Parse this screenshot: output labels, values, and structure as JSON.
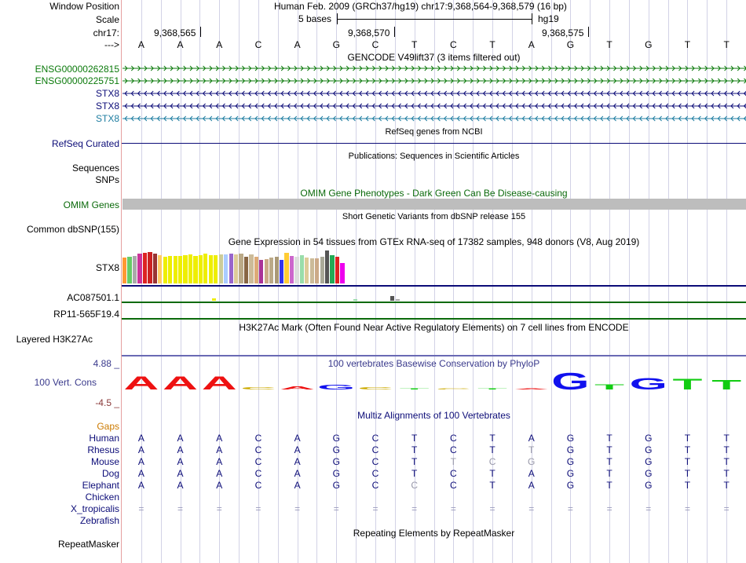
{
  "header": {
    "window_position_label": "Window Position",
    "window_position_value": "Human Feb. 2009 (GRCh37/hg19)   chr17:9,368,564-9,368,579 (16 bp)",
    "scale_label": "Scale",
    "scale_text": "5 bases",
    "scale_assembly": "hg19",
    "chrom_label": "chr17:",
    "strand_label": "--->",
    "ticks": [
      "9,368,565",
      "9,368,570",
      "9,368,575"
    ]
  },
  "dna_sequence": [
    "A",
    "A",
    "A",
    "C",
    "A",
    "G",
    "C",
    "T",
    "C",
    "T",
    "A",
    "G",
    "T",
    "G",
    "T",
    "T"
  ],
  "gencode": {
    "title": "GENCODE V49lift37 (3 items filtered out)",
    "tracks": [
      {
        "label": "ENSG00000262815",
        "strand": "forward",
        "color": "#0b7a0b"
      },
      {
        "label": "ENSG00000225751",
        "strand": "forward",
        "color": "#0b7a0b"
      },
      {
        "label": "STX8",
        "strand": "reverse",
        "color": "#0c0c78"
      },
      {
        "label": "STX8",
        "strand": "reverse",
        "color": "#0c0c78"
      },
      {
        "label": "STX8",
        "strand": "reverse",
        "color": "#1c7ca0"
      }
    ]
  },
  "refseq": {
    "title": "RefSeq genes from NCBI",
    "label": "RefSeq Curated"
  },
  "publications": {
    "title": "Publications: Sequences in Scientific Articles",
    "labels": [
      "Sequences",
      "SNPs"
    ]
  },
  "omim": {
    "title": "OMIM Gene Phenotypes - Dark Green Can Be Disease-causing",
    "label": "OMIM Genes"
  },
  "dbsnp": {
    "title": "Short Genetic Variants from dbSNP release 155",
    "label": "Common dbSNP(155)"
  },
  "gtex": {
    "title": "Gene Expression in 54 tissues from GTEx RNA-seq of 17382 samples, 948 donors (V8, Aug 2019)",
    "genes": [
      "STX8",
      "AC087501.1",
      "RP11-565F19.4"
    ],
    "stx8_bars": [
      {
        "c": "#ff9933",
        "v": 0.78
      },
      {
        "c": "#66cc66",
        "v": 0.82
      },
      {
        "c": "#aaaaaa",
        "v": 0.84
      },
      {
        "c": "#cc3399",
        "v": 0.9
      },
      {
        "c": "#dd2222",
        "v": 0.92
      },
      {
        "c": "#cc2222",
        "v": 0.96
      },
      {
        "c": "#993333",
        "v": 0.9
      },
      {
        "c": "#ffcc66",
        "v": 0.86
      },
      {
        "c": "#eeee00",
        "v": 0.82
      },
      {
        "c": "#eeee00",
        "v": 0.84
      },
      {
        "c": "#eeee00",
        "v": 0.84
      },
      {
        "c": "#eeee00",
        "v": 0.84
      },
      {
        "c": "#eeee00",
        "v": 0.86
      },
      {
        "c": "#eeee00",
        "v": 0.88
      },
      {
        "c": "#eeee00",
        "v": 0.84
      },
      {
        "c": "#eeee00",
        "v": 0.86
      },
      {
        "c": "#eeee00",
        "v": 0.9
      },
      {
        "c": "#eeee00",
        "v": 0.86
      },
      {
        "c": "#eeee00",
        "v": 0.86
      },
      {
        "c": "#cccc99",
        "v": 0.88
      },
      {
        "c": "#aaccff",
        "v": 0.88
      },
      {
        "c": "#9966cc",
        "v": 0.9
      },
      {
        "c": "#ddcc99",
        "v": 0.88
      },
      {
        "c": "#bbaa88",
        "v": 0.9
      },
      {
        "c": "#886644",
        "v": 0.8
      },
      {
        "c": "#ccbb99",
        "v": 0.88
      },
      {
        "c": "#ddaa77",
        "v": 0.8
      },
      {
        "c": "#aa3399",
        "v": 0.72
      },
      {
        "c": "#ccaa88",
        "v": 0.74
      },
      {
        "c": "#bbaa88",
        "v": 0.78
      },
      {
        "c": "#aa9977",
        "v": 0.8
      },
      {
        "c": "#3333ee",
        "v": 0.72
      },
      {
        "c": "#ffcc33",
        "v": 0.92
      },
      {
        "c": "#cc66cc",
        "v": 0.84
      },
      {
        "c": "#dddddd",
        "v": 0.82
      },
      {
        "c": "#99ddaa",
        "v": 0.86
      },
      {
        "c": "#ddcc99",
        "v": 0.78
      },
      {
        "c": "#ccbb99",
        "v": 0.76
      },
      {
        "c": "#ccaa88",
        "v": 0.76
      },
      {
        "c": "#aaaa99",
        "v": 0.82
      },
      {
        "c": "#555555",
        "v": 1.0
      },
      {
        "c": "#22aa55",
        "v": 0.86
      },
      {
        "c": "#dd2222",
        "v": 0.82
      },
      {
        "c": "#ee00ee",
        "v": 0.62
      }
    ]
  },
  "h3k27ac": {
    "title": "H3K27Ac Mark (Often Found Near Active Regulatory Elements) on 7 cell lines from ENCODE",
    "label": "Layered H3K27Ac"
  },
  "conservation": {
    "title": "100 vertebrates Basewise Conservation by PhyloP",
    "label": "100 Vert. Cons",
    "ymax": "4.88 _",
    "ymin": "-4.5 _",
    "scores": [
      3.5,
      3.6,
      3.6,
      0.6,
      0.8,
      1.2,
      0.6,
      0.3,
      0.3,
      0.3,
      0.0,
      4.5,
      1.4,
      3.2,
      2.8,
      2.6
    ]
  },
  "multiz": {
    "title": "Multiz Alignments of 100 Vertebrates",
    "gaps_label": "Gaps",
    "species": [
      {
        "name": "Human",
        "seq": [
          "A",
          "A",
          "A",
          "C",
          "A",
          "G",
          "C",
          "T",
          "C",
          "T",
          "A",
          "G",
          "T",
          "G",
          "T",
          "T"
        ]
      },
      {
        "name": "Rhesus",
        "seq": [
          "A",
          "A",
          "A",
          "C",
          "A",
          "G",
          "C",
          "T",
          "C",
          "T",
          "T",
          "G",
          "T",
          "G",
          "T",
          "T"
        ]
      },
      {
        "name": "Mouse",
        "seq": [
          "A",
          "A",
          "A",
          "C",
          "A",
          "G",
          "C",
          "T",
          "T",
          "C",
          "G",
          "G",
          "T",
          "G",
          "T",
          "T"
        ]
      },
      {
        "name": "Dog",
        "seq": [
          "A",
          "A",
          "A",
          "C",
          "A",
          "G",
          "C",
          "T",
          "C",
          "T",
          "A",
          "G",
          "T",
          "G",
          "T",
          "T"
        ]
      },
      {
        "name": "Elephant",
        "seq": [
          "A",
          "A",
          "A",
          "C",
          "A",
          "G",
          "C",
          "C",
          "C",
          "T",
          "A",
          "G",
          "T",
          "G",
          "T",
          "T"
        ]
      },
      {
        "name": "Chicken",
        "seq": []
      },
      {
        "name": "X_tropicalis",
        "seq": [
          "=",
          "=",
          "=",
          "=",
          "=",
          "=",
          "=",
          "=",
          "=",
          "=",
          "=",
          "=",
          "=",
          "=",
          "=",
          "="
        ]
      },
      {
        "name": "Zebrafish",
        "seq": []
      }
    ]
  },
  "repeatmasker": {
    "title": "Repeating Elements by RepeatMasker",
    "label": "RepeatMasker"
  },
  "colors": {
    "A": "#ee1111",
    "C": "#ccaa00",
    "G": "#1111ee",
    "T": "#11cc11",
    "navy": "#0c0c78",
    "green": "#0b7a0b",
    "omim": "#0b6a0b",
    "gaps": "#cc7a00",
    "cons": "#3a3a8c"
  }
}
